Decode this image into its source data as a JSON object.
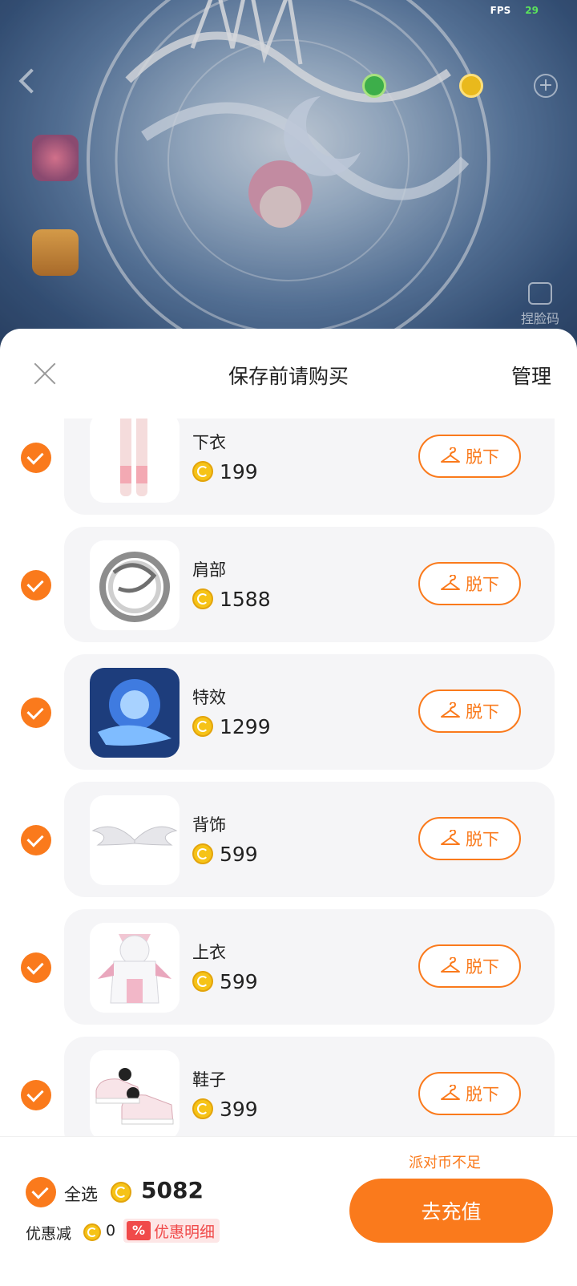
{
  "status": {
    "fps_label": "FPS",
    "fps_value": "29"
  },
  "background": {
    "side_labels": [
      "",
      ""
    ],
    "face_code_label": "捏脸码"
  },
  "sheet": {
    "title": "保存前请购买",
    "manage": "管理",
    "takeoff_label": "脱下"
  },
  "items": [
    {
      "name": "下衣",
      "price": "199",
      "icon": "legs-thumbnail"
    },
    {
      "name": "肩部",
      "price": "1588",
      "icon": "dragon-ring-thumbnail"
    },
    {
      "name": "特效",
      "price": "1299",
      "icon": "blue-effect-thumbnail"
    },
    {
      "name": "背饰",
      "price": "599",
      "icon": "wings-thumbnail"
    },
    {
      "name": "上衣",
      "price": "599",
      "icon": "hoodie-thumbnail"
    },
    {
      "name": "鞋子",
      "price": "399",
      "icon": "sneakers-thumbnail"
    }
  ],
  "footer": {
    "insufficient": "派对币不足",
    "select_all": "全选",
    "total": "5082",
    "discount_label": "优惠减",
    "discount_value": "0",
    "detail_icon": "%",
    "detail_label": "优惠明细",
    "recharge": "去充值"
  },
  "colors": {
    "accent": "#fa7a1c",
    "coin": "#f6c317",
    "card_bg": "#f5f5f7",
    "danger": "#f04a4a"
  }
}
